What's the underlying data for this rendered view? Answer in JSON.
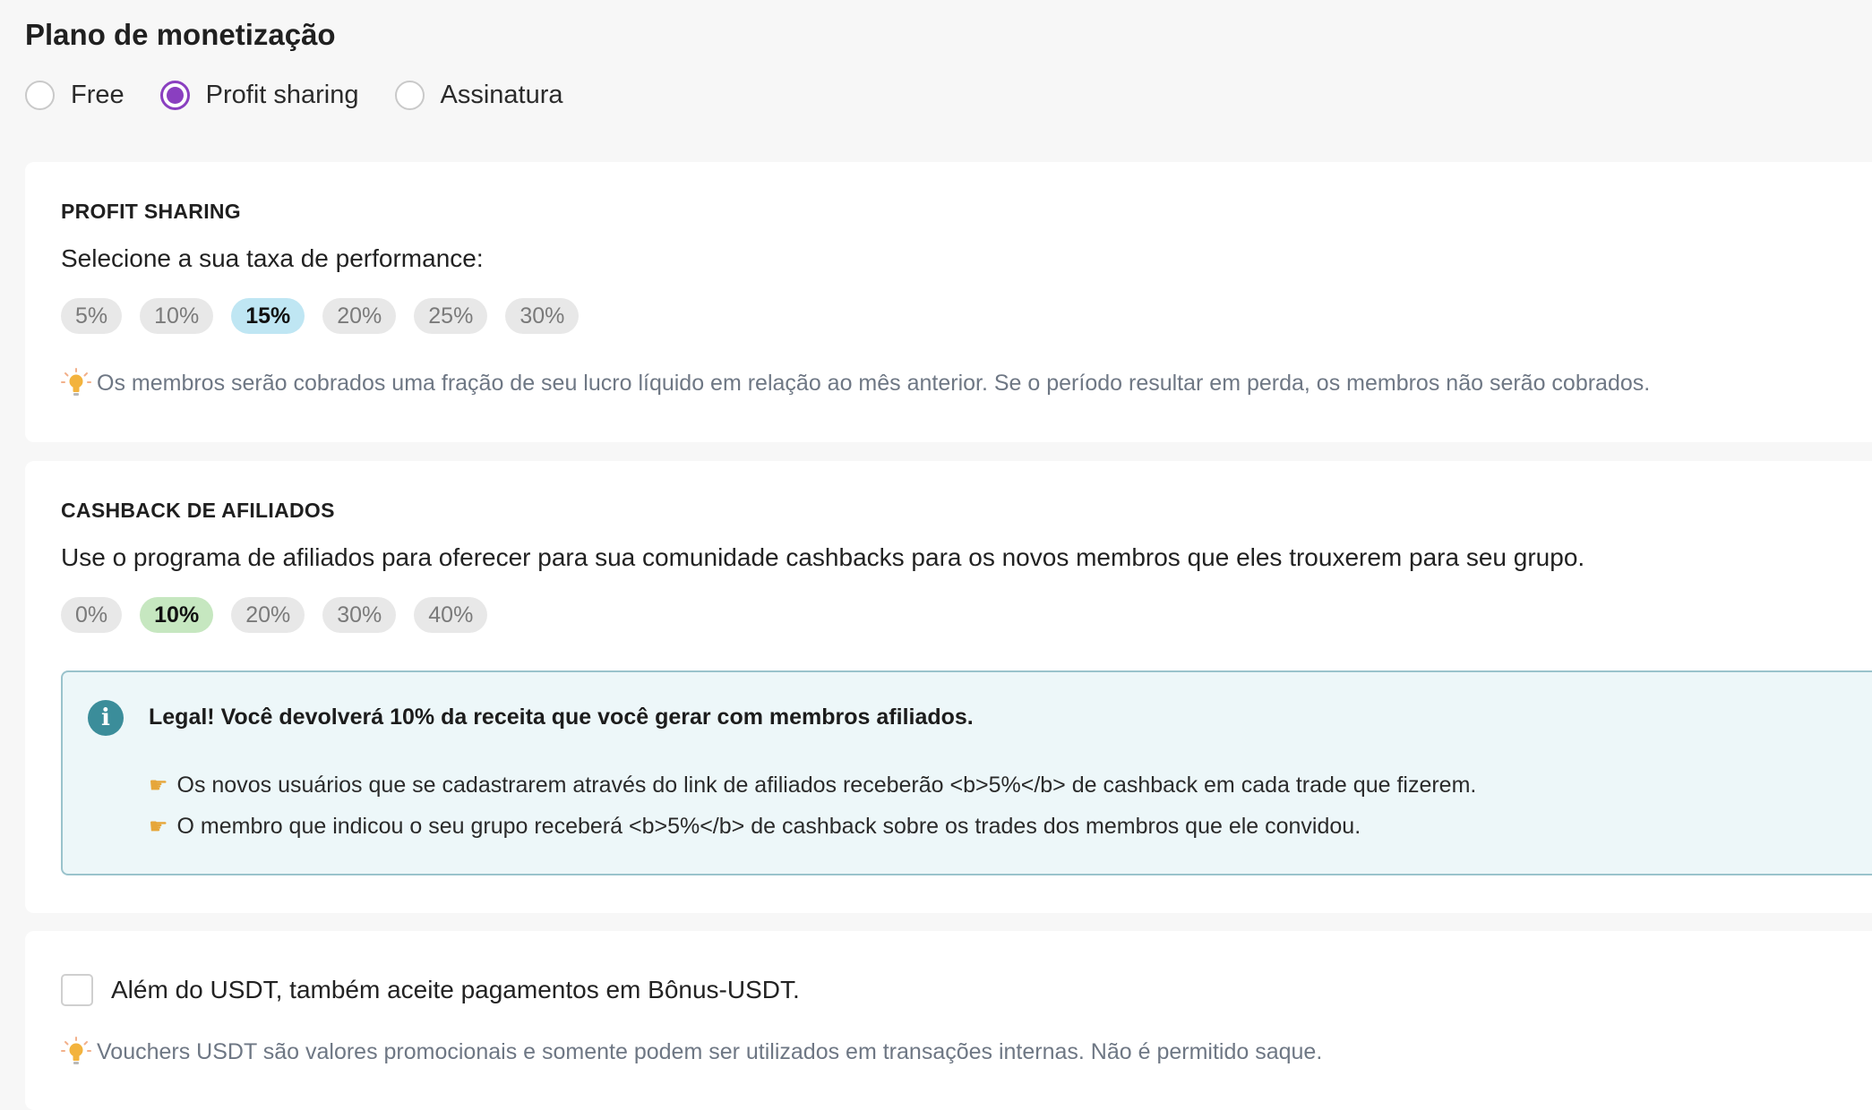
{
  "page_title": "Plano de monetização",
  "plan": {
    "options": [
      {
        "label": "Free",
        "selected": false
      },
      {
        "label": "Profit sharing",
        "selected": true
      },
      {
        "label": "Assinatura",
        "selected": false
      }
    ],
    "accent_color": "#8a3fc0"
  },
  "profit_sharing": {
    "title": "PROFIT SHARING",
    "description": "Selecione a sua taxa de performance:",
    "rates": [
      "5%",
      "10%",
      "15%",
      "20%",
      "25%",
      "30%"
    ],
    "selected_rate": "15%",
    "hint_icon": "lightbulb-icon",
    "hint": "Os membros serão cobrados uma fração de seu lucro líquido em relação ao mês anterior. Se o período resultar em perda, os membros não serão cobrados."
  },
  "cashback": {
    "title": "CASHBACK DE AFILIADOS",
    "description": "Use o programa de afiliados para oferecer para sua comunidade cashbacks para os novos membros que eles trouxerem para seu grupo.",
    "rates": [
      "0%",
      "10%",
      "20%",
      "30%",
      "40%"
    ],
    "selected_rate": "10%",
    "info": {
      "icon": "info-icon",
      "title": "Legal! Você devolverá 10% da receita que você gerar com membros afiliados.",
      "lines": [
        "Os novos usuários que se cadastrarem através do link de afiliados receberão <b>5%</b> de cashback em cada trade que fizerem.",
        "O membro que indicou o seu grupo receberá <b>5%</b> de cashback sobre os trades dos membros que ele convidou."
      ],
      "line_icon": "pointing-hand-icon"
    }
  },
  "bonus_usdt": {
    "checkbox_label": "Além do USDT, também aceite pagamentos em Bônus-USDT.",
    "checked": false,
    "hint_icon": "lightbulb-icon",
    "hint": "Vouchers USDT são valores promocionais e somente podem ser utilizados em transações internas. Não é permitido saque."
  }
}
